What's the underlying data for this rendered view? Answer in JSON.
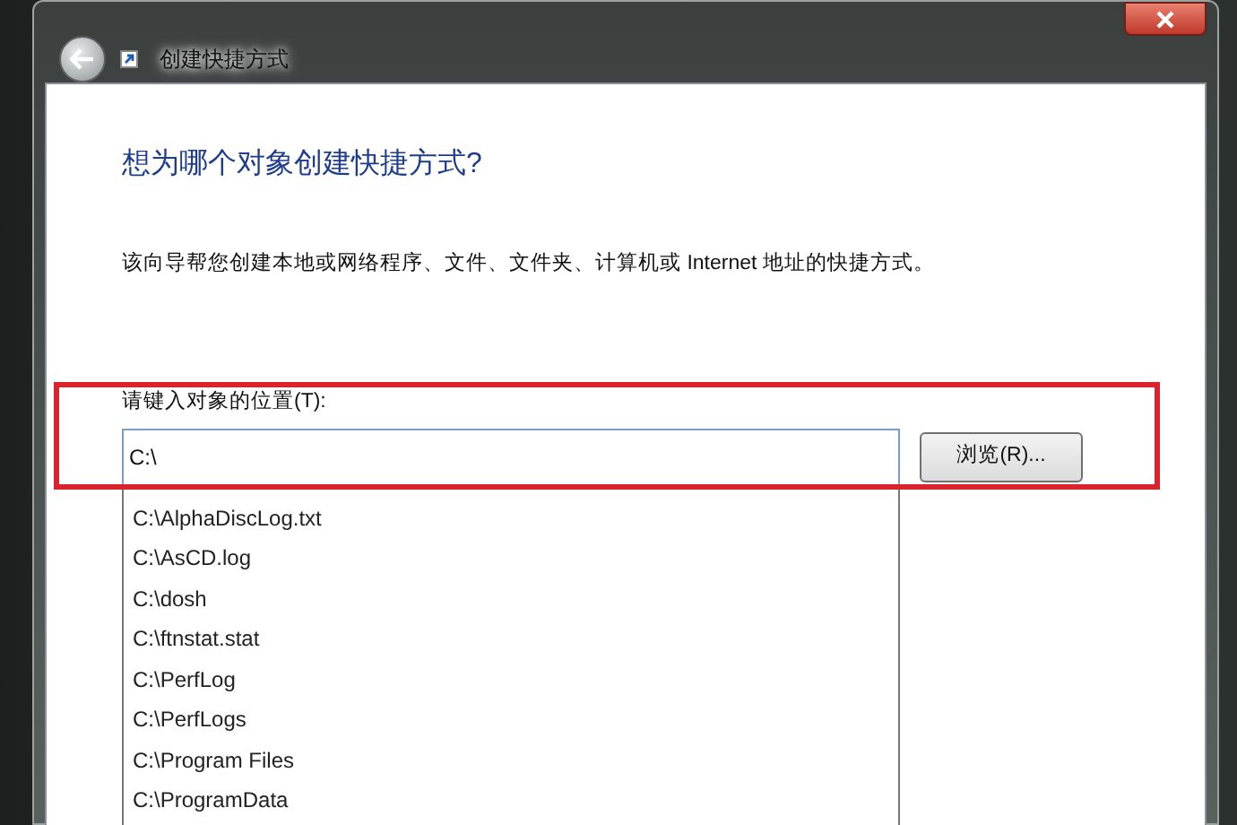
{
  "window": {
    "title": "创建快捷方式"
  },
  "heading": "想为哪个对象创建快捷方式?",
  "description": "该向导帮您创建本地或网络程序、文件、文件夹、计算机或 Internet 地址的快捷方式。",
  "location": {
    "label": "请键入对象的位置(T):",
    "value": "C:\\"
  },
  "browse_button": "浏览(R)...",
  "suggestions": [
    "C:\\AlphaDiscLog.txt",
    "C:\\AsCD.log",
    "C:\\dosh",
    "C:\\ftnstat.stat",
    "C:\\PerfLog",
    "C:\\PerfLogs",
    "C:\\Program Files",
    "C:\\ProgramData"
  ]
}
